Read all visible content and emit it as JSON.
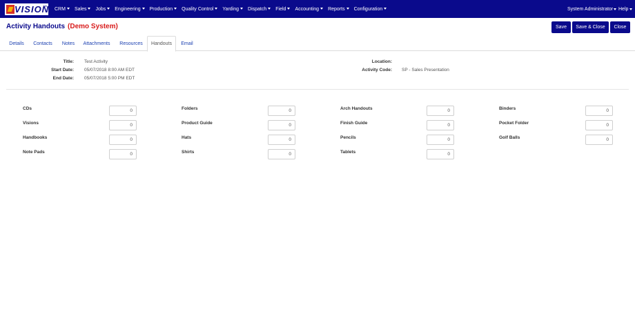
{
  "nav": {
    "logo_text": "VISION",
    "logo_tm": "TM",
    "menu": [
      {
        "label": "CRM"
      },
      {
        "label": "Sales"
      },
      {
        "label": "Jobs"
      },
      {
        "label": "Engineering"
      },
      {
        "label": "Production"
      },
      {
        "label": "Quality Control"
      },
      {
        "label": "Yarding"
      },
      {
        "label": "Dispatch"
      },
      {
        "label": "Field"
      },
      {
        "label": "Accounting"
      },
      {
        "label": "Reports"
      },
      {
        "label": "Configuration"
      }
    ],
    "user": "System Administrator",
    "help": "Help"
  },
  "header": {
    "title": "Activity Handouts",
    "subtitle": "(Demo System)",
    "buttons": {
      "save": "Save",
      "save_close": "Save & Close",
      "close": "Close"
    }
  },
  "tabs": [
    {
      "label": "Details"
    },
    {
      "label": "Contacts"
    },
    {
      "label": "Notes"
    },
    {
      "label": "Attachments"
    },
    {
      "label": "Resources"
    },
    {
      "label": "Handouts",
      "active": true
    },
    {
      "label": "Email"
    }
  ],
  "activity": {
    "title_label": "Title:",
    "title_value": "Test Activity",
    "start_label": "Start Date:",
    "start_value": "05/07/2018 8:00 AM EDT",
    "end_label": "End Date:",
    "end_value": "05/07/2018 5:00 PM EDT",
    "location_label": "Location:",
    "location_value": "",
    "code_label": "Activity Code:",
    "code_value": "SP - Sales Presentation"
  },
  "handouts": [
    {
      "label": "CDs",
      "value": "0"
    },
    {
      "label": "Folders",
      "value": "0"
    },
    {
      "label": "Arch Handouts",
      "value": "0"
    },
    {
      "label": "Binders",
      "value": "0"
    },
    {
      "label": "Visions",
      "value": "0"
    },
    {
      "label": "Product Guide",
      "value": "0"
    },
    {
      "label": "Finish Guide",
      "value": "0"
    },
    {
      "label": "Pocket Folder",
      "value": "0"
    },
    {
      "label": "Handbooks",
      "value": "0"
    },
    {
      "label": "Hats",
      "value": "0"
    },
    {
      "label": "Pencils",
      "value": "0"
    },
    {
      "label": "Golf Balls",
      "value": "0"
    },
    {
      "label": "Note Pads",
      "value": "0"
    },
    {
      "label": "Shirts",
      "value": "0"
    },
    {
      "label": "Tablets",
      "value": "0"
    }
  ],
  "colors": {
    "nav_bg": "#0a0a8c",
    "title": "#0a0a8c",
    "demo": "#d81b1b",
    "tab_link": "#1a3fb0"
  }
}
